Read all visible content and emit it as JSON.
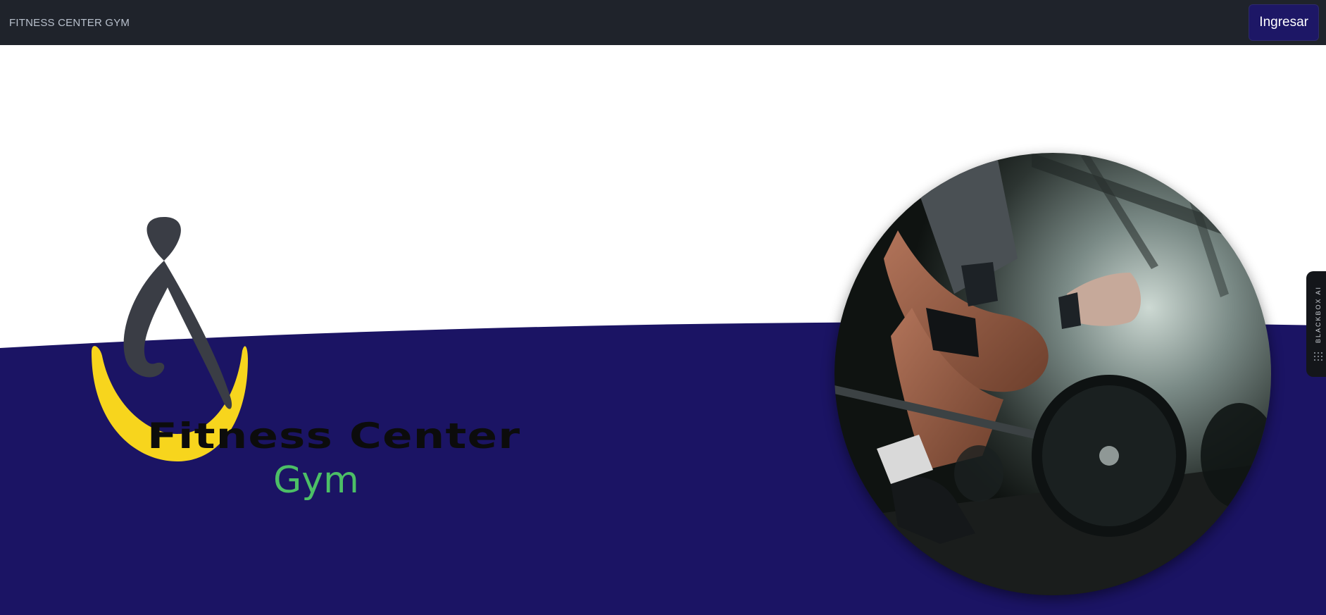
{
  "navbar": {
    "brand": "FITNESS CENTER GYM",
    "login_label": "Ingresar"
  },
  "hero": {
    "logo_title": "Fitness Center",
    "logo_subtitle": "Gym"
  },
  "side_widget": {
    "label": "BLACKBOX AI"
  },
  "colors": {
    "navbar_bg": "#1f232b",
    "wave_bg": "#1b1464",
    "logo_yellow": "#f7d51d",
    "logo_gray": "#3a3d45",
    "subtitle_green": "#4cbf66"
  },
  "icons": [
    "fitness-logo-icon",
    "dots-grid-icon"
  ]
}
